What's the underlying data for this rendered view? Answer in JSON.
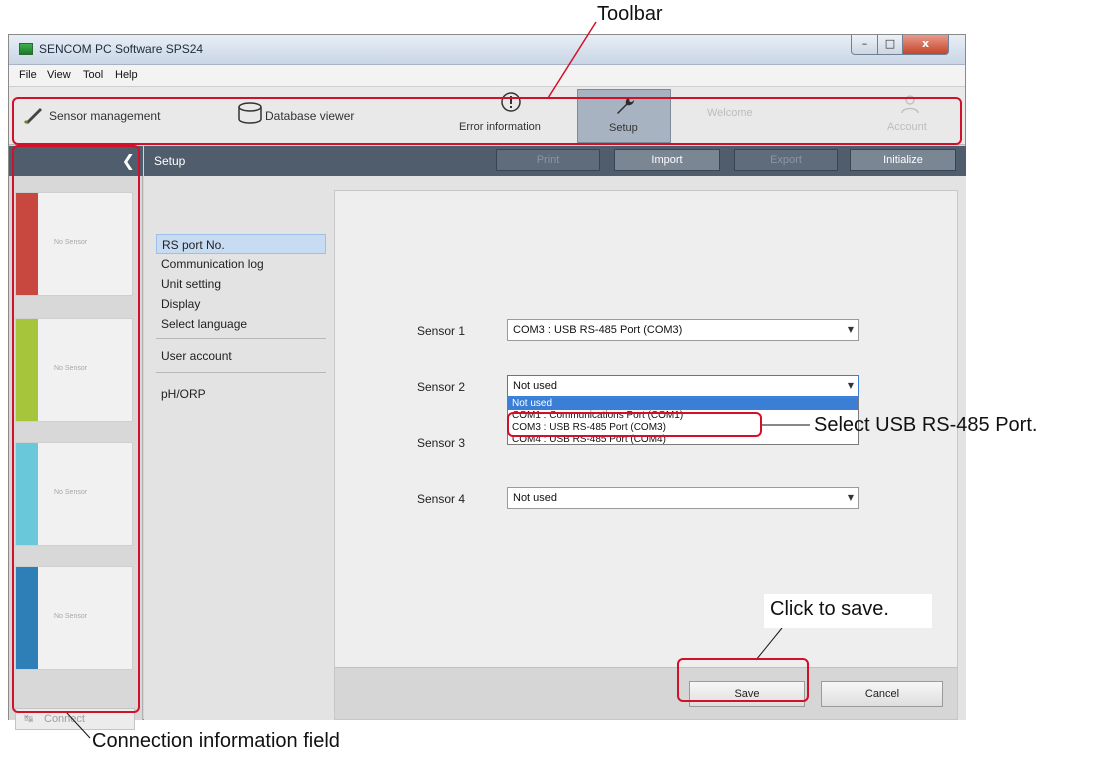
{
  "window": {
    "title": "SENCOM PC Software SPS24",
    "controls": {
      "minimize": "–",
      "maximize": "□",
      "close": "x"
    }
  },
  "menu": [
    "File",
    "View",
    "Tool",
    "Help"
  ],
  "toolbar": {
    "sensor_management": "Sensor management",
    "database_viewer": "Database viewer",
    "error_information": "Error information",
    "setup": "Setup",
    "welcome": "Welcome",
    "account": "Account"
  },
  "left_panel": {
    "sensors": [
      {
        "label": "No Sensor",
        "color": "#c8473f"
      },
      {
        "label": "No Sensor",
        "color": "#a7c53a"
      },
      {
        "label": "No Sensor",
        "color": "#6ac8db"
      },
      {
        "label": "No Sensor",
        "color": "#2e7eb8"
      }
    ],
    "connect": "Connect"
  },
  "main": {
    "title": "Setup",
    "header_buttons": {
      "print": "Print",
      "import": "Import",
      "export": "Export",
      "initialize": "Initialize"
    },
    "nav": {
      "rs_port": "RS port No.",
      "communication_log": "Communication log",
      "unit_setting": "Unit setting",
      "display": "Display",
      "select_language": "Select language",
      "user_account": "User account",
      "ph_orp": "pH/ORP"
    },
    "sensors": [
      {
        "name": "Sensor 1",
        "value": "COM3 : USB RS-485 Port (COM3)"
      },
      {
        "name": "Sensor 2",
        "value": "Not used"
      },
      {
        "name": "Sensor 3",
        "value": ""
      },
      {
        "name": "Sensor 4",
        "value": "Not used"
      }
    ],
    "dropdown_options": [
      "Not used",
      "COM1 : Communications Port (COM1)",
      "COM3 : USB RS-485 Port (COM3)",
      "COM4 : USB RS-485 Port (COM4)"
    ],
    "save": "Save",
    "cancel": "Cancel"
  },
  "callouts": {
    "toolbar": "Toolbar",
    "select_port": "Select USB RS-485 Port.",
    "click_save": "Click to save.",
    "connection_info": "Connection information field"
  },
  "colors": {
    "accent_red": "#d3102a",
    "header_dark": "#4f5d6c",
    "selection": "#3a7fd5"
  }
}
